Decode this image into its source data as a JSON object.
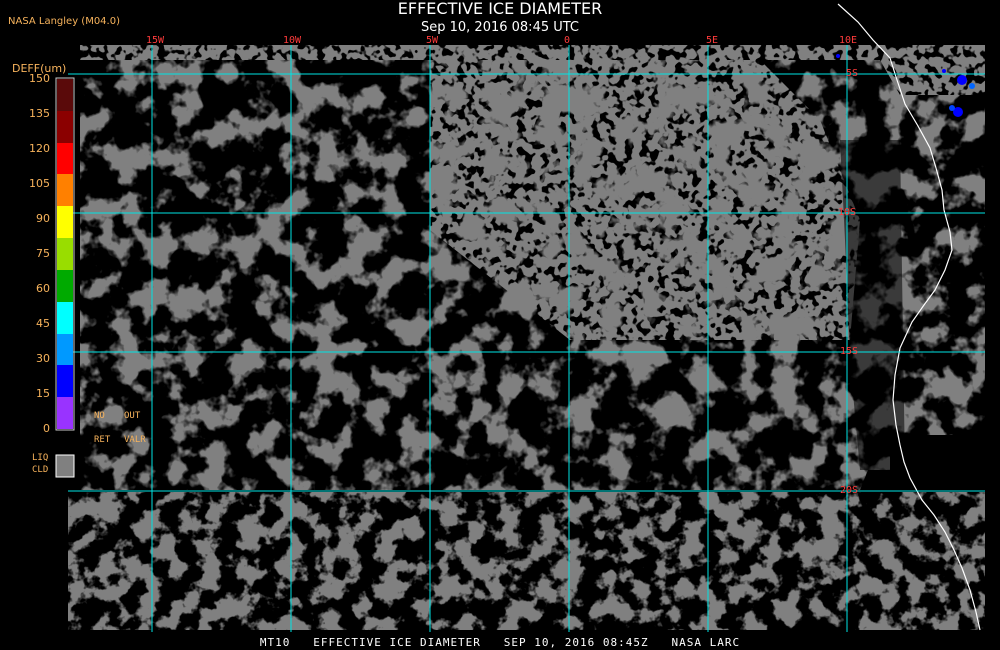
{
  "header": {
    "title": "EFFECTIVE ICE DIAMETER",
    "subtitle": "Sep 10, 2016 08:45 UTC",
    "source": "NASA Langley (M04.0)"
  },
  "colorbar": {
    "title": "DEFF(um)",
    "ticks": [
      "150",
      "135",
      "120",
      "105",
      "90",
      "75",
      "60",
      "45",
      "30",
      "15",
      "0"
    ],
    "colors": [
      "#5a0a0a",
      "#8b0000",
      "#ff0000",
      "#ff8000",
      "#ffff00",
      "#99dd00",
      "#00aa00",
      "#00ffff",
      "#0099ff",
      "#0000ff",
      "#9933ff"
    ],
    "no_ret": "NO\nRET",
    "out_valr": "OUT\nVALR",
    "liq_label": "LIQ\nCLD",
    "liq_color": "#808080"
  },
  "grid": {
    "lon_labels": [
      "15W",
      "10W",
      "5W",
      "0",
      "5E",
      "10E"
    ],
    "lat_labels": [
      "5S",
      "10S",
      "15S",
      "20S"
    ],
    "color": "#00e5e5"
  },
  "colors": {
    "liquid_cloud": "#808080",
    "clear": "#000000",
    "coastline": "#ffffff",
    "ice_small": "#0000ff"
  },
  "footer": "MT10   EFFECTIVE ICE DIAMETER   SEP 10, 2016 08:45Z   NASA LARC"
}
